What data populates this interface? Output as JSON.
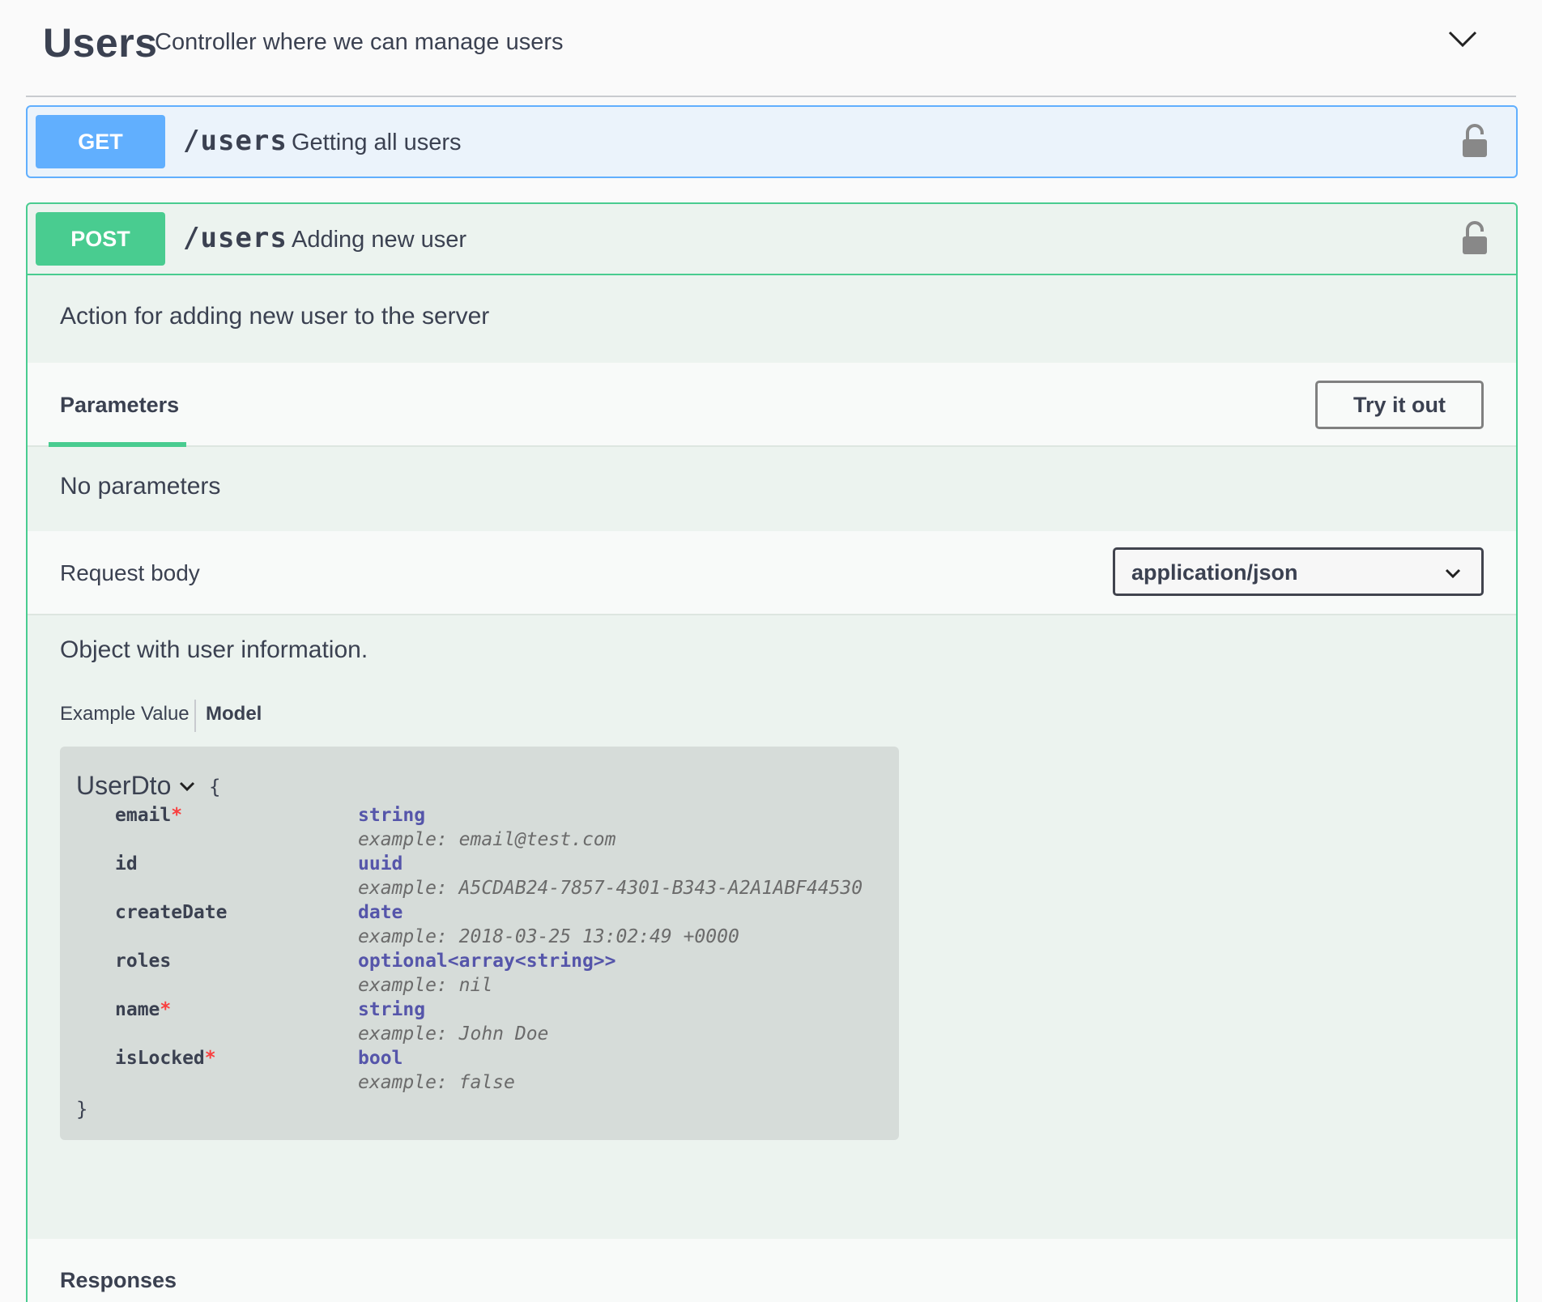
{
  "section": {
    "title": "Users",
    "description": "Controller where we can manage users"
  },
  "get_op": {
    "method": "GET",
    "path": "/users",
    "summary": "Getting all users"
  },
  "post_op": {
    "method": "POST",
    "path": "/users",
    "summary": "Adding new user",
    "description": "Action for adding new user to the server",
    "parameters_tab": "Parameters",
    "try_it_out_label": "Try it out",
    "no_parameters_text": "No parameters",
    "request_body_label": "Request body",
    "content_type": "application/json",
    "body_description": "Object with user information.",
    "example_value_tab": "Example Value",
    "model_tab": "Model",
    "responses_label": "Responses"
  },
  "model": {
    "name": "UserDto",
    "open_brace": "{",
    "close_brace": "}",
    "properties": [
      {
        "name": "email",
        "required": "*",
        "type": "string",
        "example": "example: email@test.com"
      },
      {
        "name": "id",
        "required": "",
        "type": "uuid",
        "example": "example: A5CDAB24-7857-4301-B343-A2A1ABF44530"
      },
      {
        "name": "createDate",
        "required": "",
        "type": "date",
        "example": "example: 2018-03-25 13:02:49 +0000"
      },
      {
        "name": "roles",
        "required": "",
        "type": "optional<array<string>>",
        "example": "example: nil"
      },
      {
        "name": "name",
        "required": "*",
        "type": "string",
        "example": "example: John Doe"
      },
      {
        "name": "isLocked",
        "required": "*",
        "type": "bool",
        "example": "example: false"
      }
    ]
  },
  "colors": {
    "get": "#61affe",
    "post": "#49cc90",
    "required": "#f93e3e",
    "type": "#55a"
  },
  "icons": {
    "collapse": "chevron-down-icon",
    "lock": "lock-icon",
    "select": "chevron-down-icon",
    "model_toggle": "chevron-down-icon"
  }
}
